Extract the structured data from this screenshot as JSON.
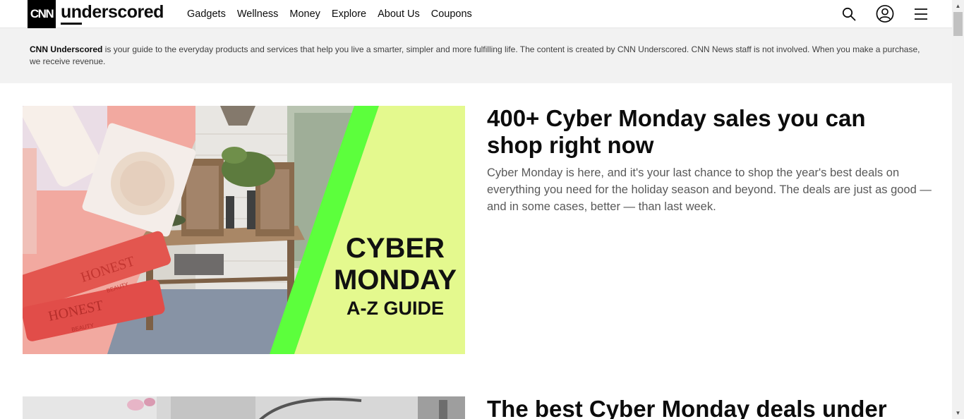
{
  "header": {
    "logo_mark": "CNN",
    "brand": "underscored",
    "nav": [
      "Gadgets",
      "Wellness",
      "Money",
      "Explore",
      "About Us",
      "Coupons"
    ],
    "icons": [
      "search-icon",
      "account-icon",
      "menu-icon"
    ]
  },
  "disclaimer": {
    "brand": "CNN Underscored",
    "text": " is your guide to the everyday products and services that help you live a smarter, simpler and more fulfilling life. The content is created by CNN Underscored. CNN News staff is not involved. When you make a purchase, we receive revenue."
  },
  "articles": [
    {
      "title": "400+ Cyber Monday sales you can shop right now",
      "description": "Cyber Monday is here, and it's your last chance to shop the year's best deals on everything you need for the holiday season and beyond. The deals are just as good — and in some cases, better — than last week.",
      "image_text": [
        "CYBER",
        "MONDAY",
        "A-Z GUIDE"
      ],
      "product_text": [
        "HONEST",
        "BEAUTY",
        "HONEST",
        "BEAUTY"
      ]
    },
    {
      "title": "The best Cyber Monday deals under"
    }
  ],
  "colors": {
    "accent_green": "#5cff3c",
    "banner_lime": "#e4f98e",
    "text_dark": "#0c0c0c",
    "text_gray": "#595959"
  }
}
